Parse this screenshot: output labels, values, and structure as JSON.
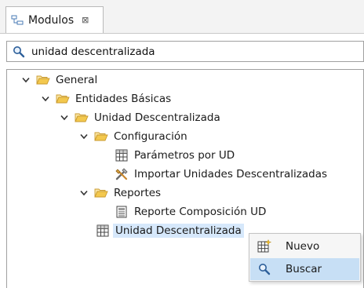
{
  "view": {
    "tab_label": "Modulos",
    "close_symbol": "⊠",
    "tab_icon": "hierarchy-icon"
  },
  "search": {
    "value": "unidad descentralizada",
    "icon": "search-icon"
  },
  "tree": {
    "general": "General",
    "entidades": "Entidades Básicas",
    "unidad_folder": "Unidad Descentralizada",
    "configuracion": "Configuración",
    "parametros": "Parámetros por UD",
    "importar": "Importar Unidades Descentralizadas",
    "reportes": "Reportes",
    "reporte_composicion": "Reporte Composición UD",
    "unidad_item": "Unidad Descentralizada"
  },
  "context_menu": {
    "nuevo": "Nuevo",
    "buscar": "Buscar"
  },
  "colors": {
    "selection": "#d6e8fb",
    "menu_highlight": "#c7dff5",
    "folder": "#e9b949"
  }
}
